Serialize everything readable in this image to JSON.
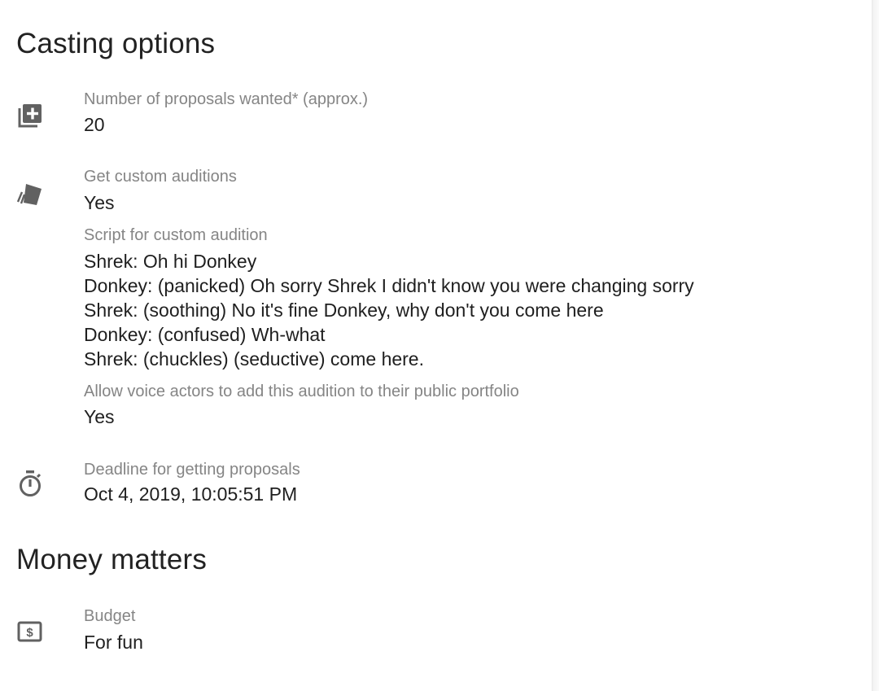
{
  "casting": {
    "title": "Casting options",
    "proposals": {
      "icon": "add-box-stack-icon",
      "label": "Number of proposals wanted* (approx.)",
      "value": "20"
    },
    "custom_auditions": {
      "icon": "tickets-icon",
      "label": "Get custom auditions",
      "value": "Yes"
    },
    "script": {
      "label": "Script for custom audition",
      "lines": [
        "Shrek: Oh hi Donkey",
        "Donkey: (panicked) Oh sorry Shrek I didn't know you were changing sorry",
        "Shrek: (soothing) No it's fine Donkey, why don't you come here",
        "Donkey: (confused) Wh-what",
        "Shrek: (chuckles) (seductive) come here."
      ]
    },
    "portfolio": {
      "label": "Allow voice actors to add this audition to their public portfolio",
      "value": "Yes"
    },
    "deadline": {
      "icon": "stopwatch-icon",
      "label": "Deadline for getting proposals",
      "value": "Oct 4, 2019, 10:05:51 PM"
    }
  },
  "money": {
    "title": "Money matters",
    "budget": {
      "icon": "dollar-bill-icon",
      "label": "Budget",
      "value": "For fun"
    }
  },
  "colors": {
    "icon": "#616161",
    "label": "#858585",
    "value": "#1f1f1f",
    "heading": "#222222"
  }
}
